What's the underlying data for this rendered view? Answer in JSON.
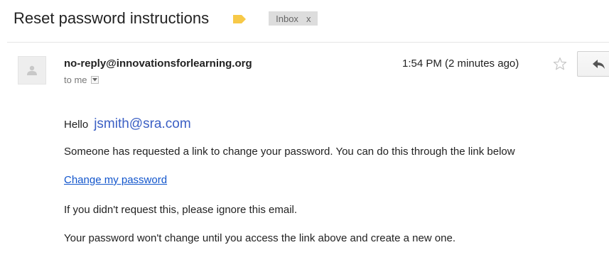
{
  "email": {
    "subject": "Reset password instructions",
    "label_color": "#f7c948",
    "inbox_label": "Inbox",
    "inbox_remove": "x",
    "sender": "no-reply@innovationsforlearning.org",
    "to_line": "to me",
    "timestamp": "1:54 PM (2 minutes ago)",
    "icons": {
      "avatar": "person-icon",
      "label": "label-tag-icon",
      "star": "star-icon",
      "reply": "reply-arrow-icon",
      "dropdown": "caret-down-icon"
    }
  },
  "body": {
    "greeting": "Hello",
    "greeting_email": "jsmith@sra.com",
    "line_request": "Someone has requested a link to change your password. You can do this through the link below",
    "link_text": "Change my password",
    "line_ignore": "If you didn't request this, please ignore this email.",
    "line_info": "Your password won't change until you access the link above and create a new one."
  }
}
